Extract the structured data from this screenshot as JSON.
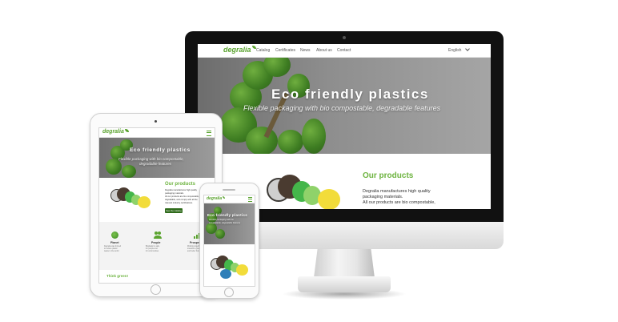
{
  "desktop": {
    "logo": "degralia",
    "nav": [
      "Catalog",
      "Certificates",
      "News",
      "About us",
      "Contact"
    ],
    "language": "English",
    "hero_title": "Eco friendly plastics",
    "hero_subtitle": "Flexible packaging with bio compostable, degradable features",
    "products_title": "Our products",
    "products_text": [
      "Degralia manufactures high quality",
      "packaging materials.",
      "All our products are bio compostable,"
    ]
  },
  "tablet": {
    "logo": "degralia",
    "hero_title": "Eco friendly plastics",
    "hero_subtitle": [
      "Flexible packaging with bio compostable,",
      "degradable features"
    ],
    "products_title": "Our products",
    "products_text": [
      "Degralia manufactures high quality",
      "packaging materials.",
      "All our products are bio compostable,",
      "degradable, and comply with all the",
      "relevant industry certifications."
    ],
    "catalog_button": "See the catalog",
    "features": [
      {
        "name": "Planet",
        "icon": "globe-icon"
      },
      {
        "name": "People",
        "icon": "people-icon"
      },
      {
        "name": "Prosperity",
        "icon": "chart-icon"
      }
    ],
    "feature_texts": [
      [
        "Degralia was formed",
        "to reduce plastic",
        "waste in the world"
      ],
      [
        "Bioplastic is safe",
        "for people and",
        "for communities"
      ],
      [
        "Working together",
        "towards a greener",
        "and better future"
      ]
    ],
    "footer_title": "Think green!"
  },
  "phone": {
    "logo": "degralia",
    "hero_title": "Eco friendly plastics",
    "hero_subtitle": [
      "Flexible packaging with bio",
      "compostable, degradable features"
    ]
  },
  "colors": {
    "brand_green": "#5aa32e",
    "accent_green": "#6cb33e",
    "button_green": "#2f6b1b",
    "device_black": "#111111"
  }
}
